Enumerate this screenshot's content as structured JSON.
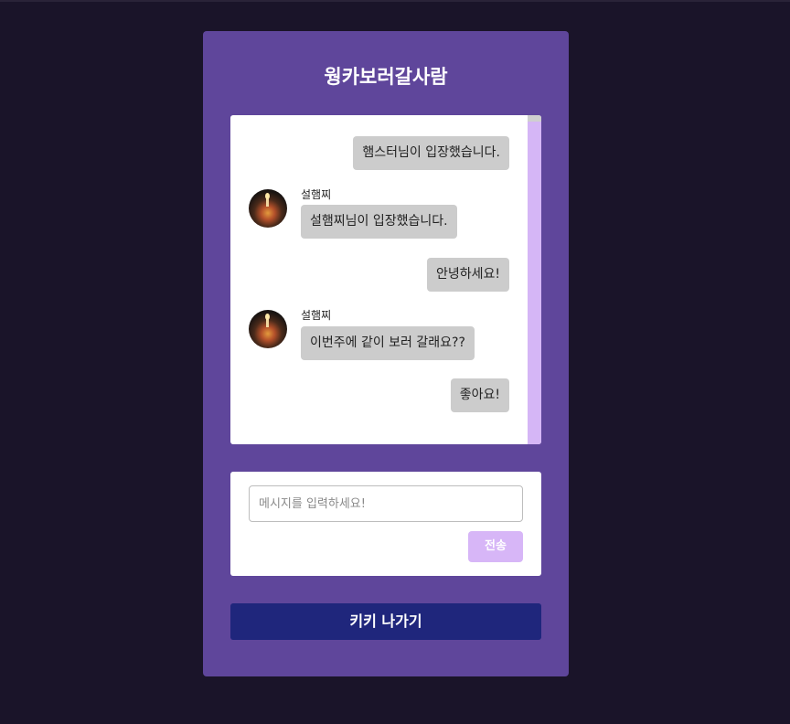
{
  "room": {
    "title": "웡카보러갈사람"
  },
  "messages": [
    {
      "type": "mine",
      "text": "햄스터님이 입장했습니다."
    },
    {
      "type": "theirs",
      "sender": "설햄찌",
      "text": "설햄찌님이 입장했습니다."
    },
    {
      "type": "mine",
      "text": "안녕하세요!"
    },
    {
      "type": "theirs",
      "sender": "설햄찌",
      "text": "이번주에 같이 보러 갈래요??"
    },
    {
      "type": "mine",
      "text": "좋아요!"
    }
  ],
  "composer": {
    "placeholder": "메시지를 입력하세요!",
    "value": "",
    "send_label": "전송"
  },
  "leave_button": {
    "label": "키키 나가기"
  },
  "colors": {
    "background": "#1a1429",
    "card": "#5f469b",
    "bubble": "#cccccc",
    "scrollbar": "#d5b6f6",
    "send_button": "#d7b6f7",
    "leave_button": "#1f267c"
  }
}
